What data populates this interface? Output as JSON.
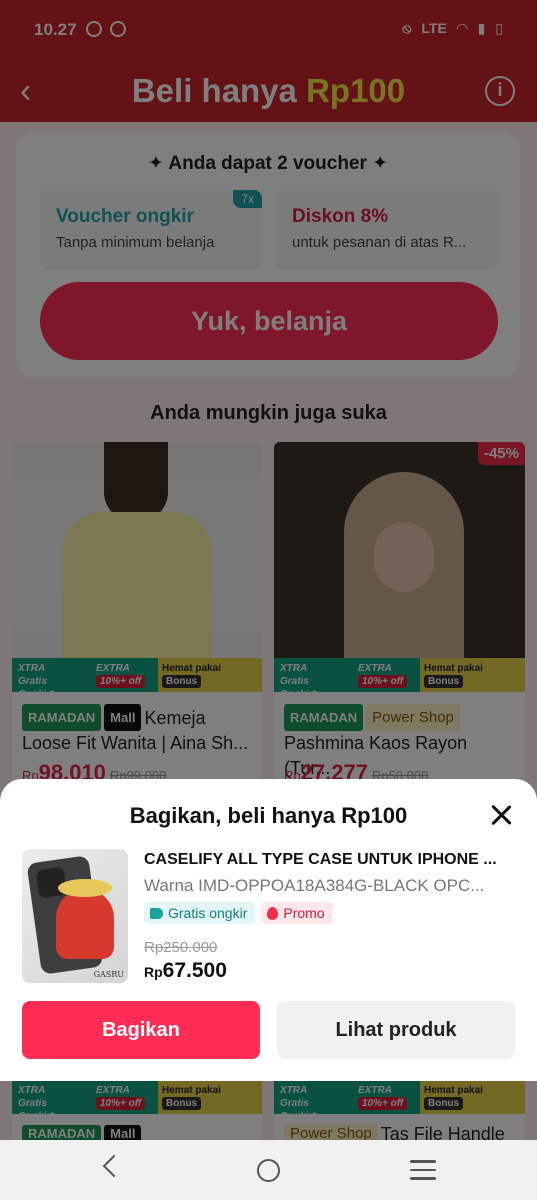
{
  "statusbar": {
    "time": "10.27",
    "network": "LTE"
  },
  "header": {
    "title_main": "Beli hanya ",
    "title_highlight": "Rp100"
  },
  "voucher": {
    "heading": "✦ Anda dapat 2 voucher ✦",
    "items": [
      {
        "title": "Voucher ongkir",
        "subtitle": "Tanpa minimum belanja",
        "badge": "7x"
      },
      {
        "title": "Diskon 8%",
        "subtitle": "untuk pesanan di atas R..."
      }
    ],
    "cta": "Yuk, belanja"
  },
  "suggest_title": "Anda mungkin juga suka",
  "products": [
    {
      "tags": [
        "RAMADAN",
        "Mall"
      ],
      "title": "Kemeja Loose Fit Wanita | Aina Sh...",
      "currency": "Rp",
      "price": "98.010",
      "old_price": "Rp99.000"
    },
    {
      "discount": "-45%",
      "tags": [
        "RAMADAN",
        "Power Shop"
      ],
      "title": "Pashmina Kaos Rayon (Tur...",
      "currency": "Rp",
      "price": "27.277",
      "old_price": "Rp50.000"
    }
  ],
  "xtra": {
    "label_a": "XTRA",
    "sub_a": "Gratis Ongkir*",
    "label_b": "EXTRA",
    "sub_b": "10%+ off",
    "label_c": "Hemat pakai",
    "sub_c": "Bonus"
  },
  "row2": [
    {
      "tags": [
        "RAMADAN",
        "Mall"
      ],
      "text": ""
    },
    {
      "tags": [
        "Power Shop"
      ],
      "text": "Tas File Handle"
    }
  ],
  "sheet": {
    "title": "Bagikan, beli hanya Rp100",
    "product_name": "CASELIFY ALL TYPE CASE UNTUK IPHONE ...",
    "variant": "Warna IMD-OPPOA18A384G-BLACK OPC...",
    "chips": [
      "Gratis ongkir",
      "Promo"
    ],
    "old_price": "Rp250.000",
    "currency": "Rp",
    "price": "67.500",
    "thumb_brand": "GASRU",
    "share_button": "Bagikan",
    "view_button": "Lihat produk"
  }
}
